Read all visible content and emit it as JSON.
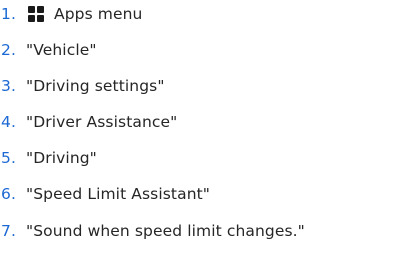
{
  "steps": [
    {
      "number": "1.",
      "text": "Apps menu",
      "icon": "apps-grid-icon"
    },
    {
      "number": "2.",
      "text": "\"Vehicle\""
    },
    {
      "number": "3.",
      "text": "\"Driving settings\""
    },
    {
      "number": "4.",
      "text": "\"Driver Assistance\""
    },
    {
      "number": "5.",
      "text": "\"Driving\""
    },
    {
      "number": "6.",
      "text": "\"Speed Limit Assistant\""
    },
    {
      "number": "7.",
      "text": "\"Sound when speed limit changes.\""
    }
  ],
  "colors": {
    "number": "#1c69d4",
    "text": "#262626",
    "icon": "#1a1a1a"
  }
}
